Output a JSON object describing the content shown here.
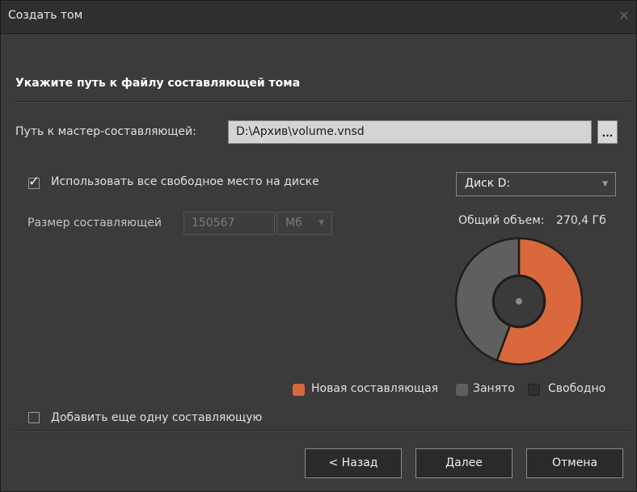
{
  "window": {
    "title": "Создать том",
    "close_symbol": "×"
  },
  "section": {
    "title": "Укажите путь к файлу составляющей тома"
  },
  "master_path": {
    "label": "Путь к мастер-составляющей:",
    "value": "D:\\Архив\\volume.vnsd",
    "browse_label": "..."
  },
  "use_all_space": {
    "label": "Использовать все свободное место на диске",
    "checked": true,
    "check_symbol": "✓"
  },
  "component_size": {
    "label": "Размер составляющей",
    "value": "150567",
    "unit": "Мб"
  },
  "disk": {
    "selected": "Диск D:",
    "total_label": "Общий объем:",
    "total_value": "270,4 Гб"
  },
  "chart_data": {
    "type": "pie",
    "series": [
      {
        "name": "Новая составляющая",
        "value": 150567,
        "color": "#d9683c"
      },
      {
        "name": "Занято",
        "value": 119833,
        "color": "#5f5f5f"
      },
      {
        "name": "Свободно",
        "value": 0,
        "color": "#333333"
      }
    ]
  },
  "legend": {
    "new_component": "Новая составляющая",
    "occupied": "Занято",
    "free": "Свободно"
  },
  "add_another": {
    "label": "Добавить еще одну составляющую",
    "checked": false
  },
  "buttons": {
    "back": "< Назад",
    "next": "Далее",
    "cancel": "Отмена"
  },
  "colors": {
    "accent": "#d9683c",
    "occupied": "#5f5f5f",
    "free": "#333333",
    "background": "#3b3b3b"
  }
}
